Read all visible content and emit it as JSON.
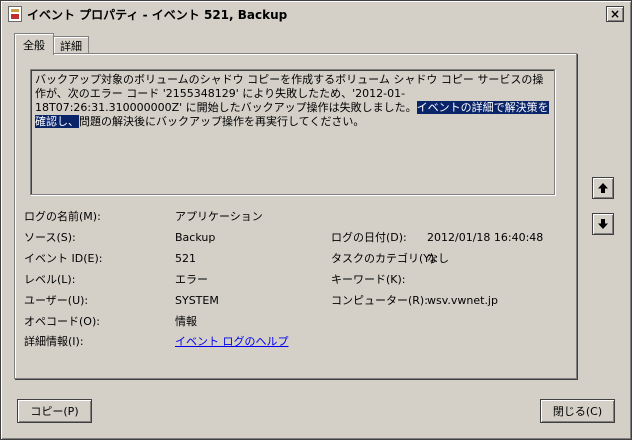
{
  "window": {
    "title": "イベント プロパティ - イベント 521, Backup",
    "close_glyph": "×"
  },
  "tabs": [
    {
      "label": "全般",
      "active": true
    },
    {
      "label": "詳細",
      "active": false
    }
  ],
  "description": {
    "before": "バックアップ対象のボリュームのシャドウ コピーを作成するボリューム シャドウ コピー サービスの操作が、次のエラー コード '2155348129' により失敗したため、'2012-01-18T07:26:31.310000000Z' に開始したバックアップ操作は失敗しました。",
    "selected": "イベントの詳細で解決策を確認し、",
    "after": "問題の解決後にバックアップ操作を再実行してください。"
  },
  "fields": {
    "log_name": {
      "label": "ログの名前(M):",
      "value": "アプリケーション"
    },
    "source": {
      "label": "ソース(S):",
      "value": "Backup"
    },
    "event_id": {
      "label": "イベント ID(E):",
      "value": "521"
    },
    "level": {
      "label": "レベル(L):",
      "value": "エラー"
    },
    "user": {
      "label": "ユーザー(U):",
      "value": "SYSTEM"
    },
    "opcode": {
      "label": "オペコード(O):",
      "value": "情報"
    },
    "more_info": {
      "label": "詳細情報(I):",
      "value": "イベント ログのヘルプ"
    },
    "logged": {
      "label": "ログの日付(D):",
      "value": "2012/01/18 16:40:48"
    },
    "task_category": {
      "label": "タスクのカテゴリ(Y):",
      "value": "なし"
    },
    "keywords": {
      "label": "キーワード(K):",
      "value": ""
    },
    "computer": {
      "label": "コンピューター(R):",
      "value": "wsv.vwnet.jp"
    }
  },
  "buttons": {
    "copy": "コピー(P)",
    "close": "閉じる(C)"
  },
  "icons": {
    "up": "arrow-up-icon",
    "down": "arrow-down-icon"
  }
}
